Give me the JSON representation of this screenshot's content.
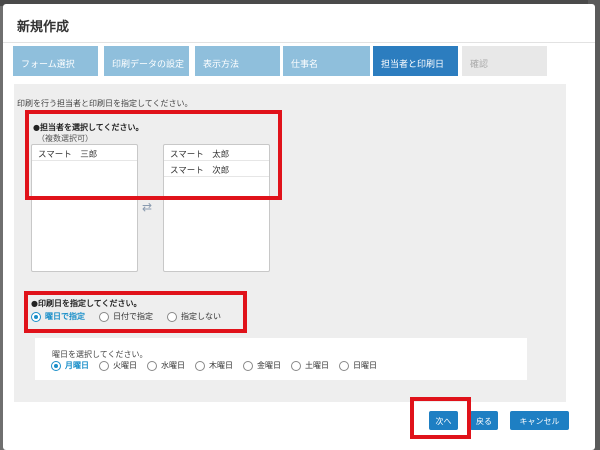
{
  "dialog": {
    "title": "新規作成"
  },
  "steps": [
    {
      "label": "フォーム選択"
    },
    {
      "label": "印刷データの設定"
    },
    {
      "label": "表示方法"
    },
    {
      "label": "仕事名"
    },
    {
      "label": "担当者と印刷日"
    },
    {
      "label": "確認"
    }
  ],
  "intro": "印刷を行う担当者と印刷日を指定してください。",
  "assignee": {
    "title": "●担当者を選択してください。",
    "subtitle": "（複数選択可）",
    "left_list": [
      "スマート　三郎"
    ],
    "right_list": [
      "スマート　太郎",
      "スマート　次郎"
    ],
    "swap_icon": "swap-arrows-icon"
  },
  "print_date": {
    "title": "●印刷日を指定してください。",
    "options": [
      "曜日で指定",
      "日付で指定",
      "指定しない"
    ],
    "selected": "曜日で指定"
  },
  "weekday": {
    "prompt": "曜日を選択してください。",
    "options": [
      "月曜日",
      "火曜日",
      "水曜日",
      "木曜日",
      "金曜日",
      "土曜日",
      "日曜日"
    ],
    "selected": "月曜日"
  },
  "buttons": {
    "next": "次へ",
    "back": "戻る",
    "cancel": "キャンセル"
  },
  "colors": {
    "accent": "#1e7fc3",
    "step_active": "#2c7dbf",
    "step_inactive": "#8fbfdc",
    "highlight": "#e0121a"
  }
}
